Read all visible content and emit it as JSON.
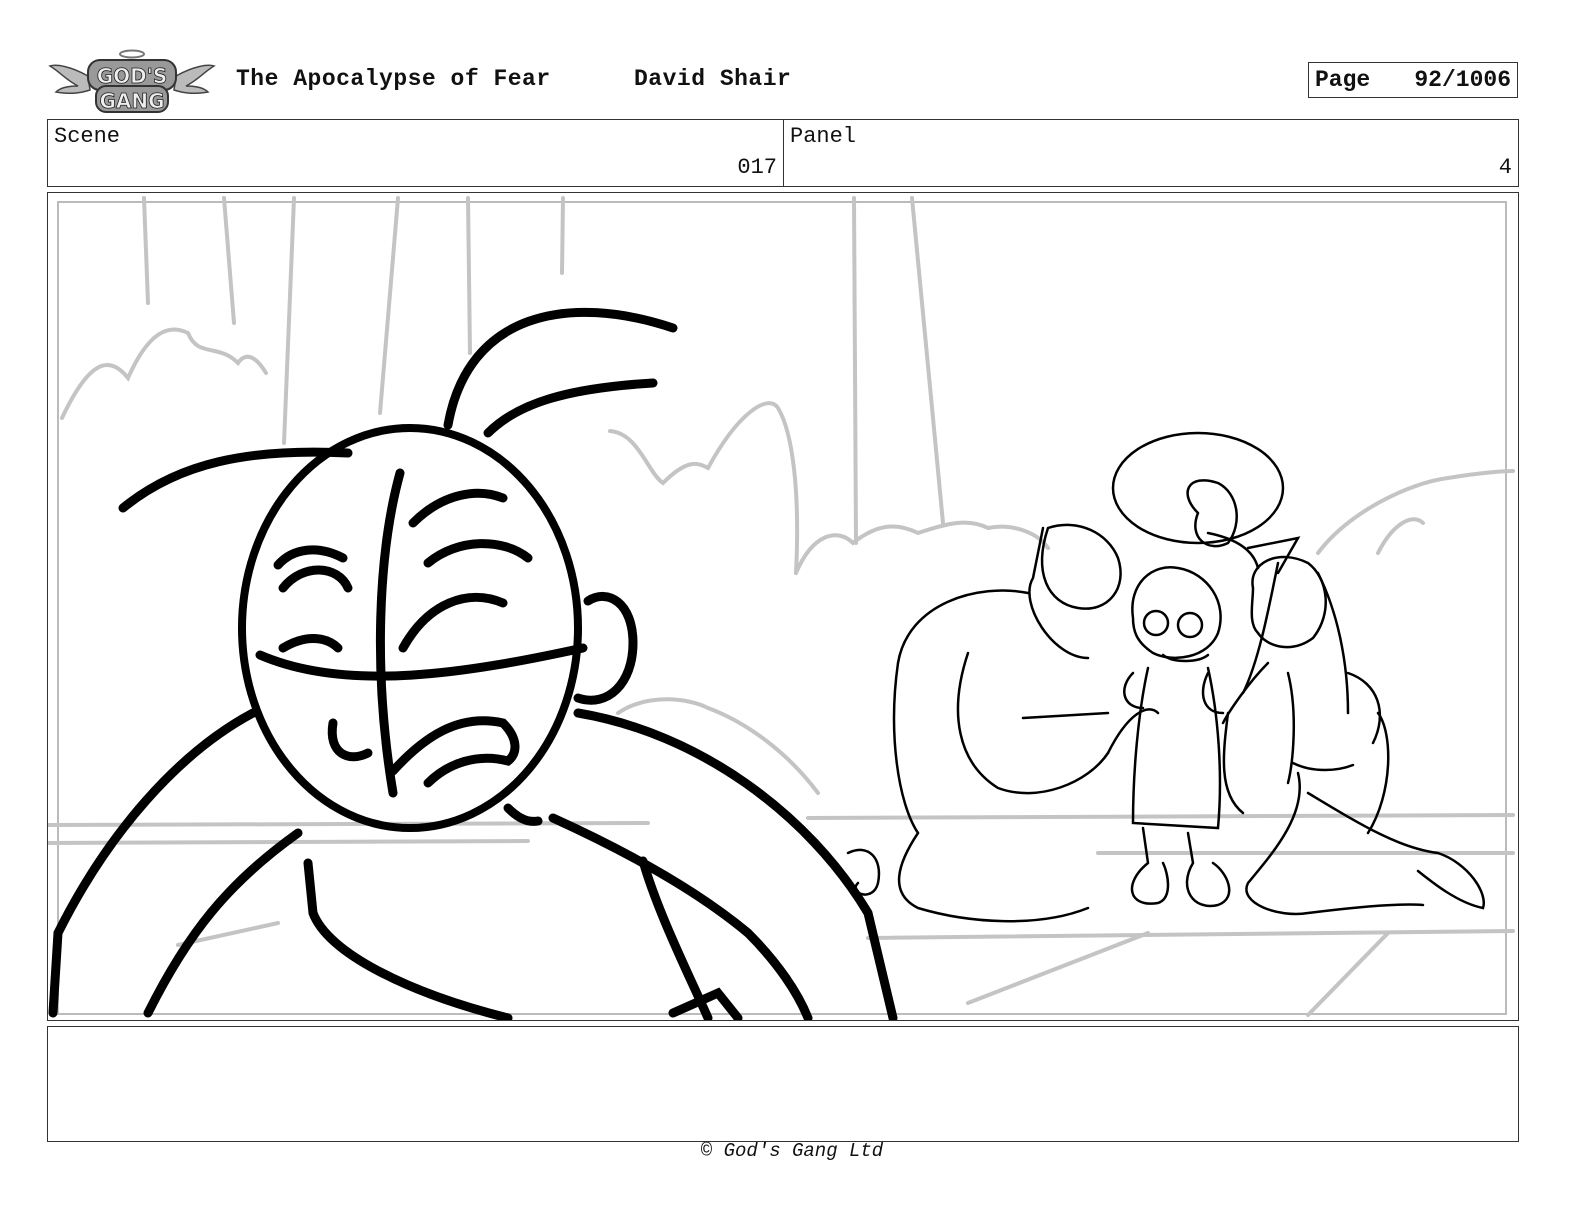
{
  "header": {
    "logo_text": "GOD'S GANG",
    "title": "The Apocalypse of Fear",
    "author": "David Shair",
    "page_label": "Page",
    "page_number": "92/1006"
  },
  "info": {
    "scene_label": "Scene",
    "scene_value": "017",
    "panel_label": "Panel",
    "panel_value": "4"
  },
  "notes": {
    "text": ""
  },
  "footer": {
    "copyright": "© God's Gang Ltd"
  }
}
